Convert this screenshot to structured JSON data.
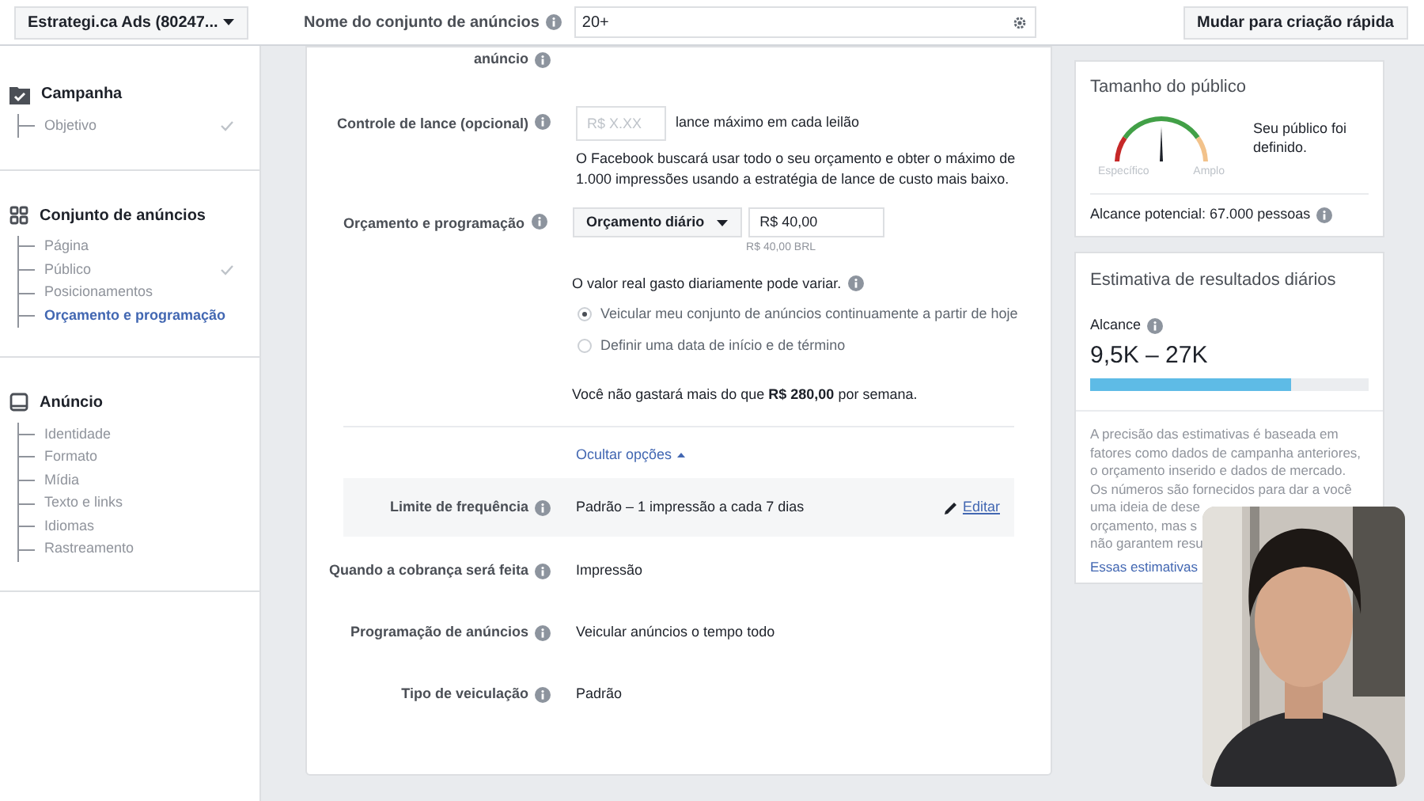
{
  "header": {
    "account": "Estrategi.ca Ads (80247...",
    "name_label": "Nome do conjunto de anúncios",
    "name_value": "20+",
    "quick_button": "Mudar para criação rápida"
  },
  "sidebar": [
    {
      "title": "Campanha",
      "kind": "campaign",
      "items": [
        {
          "label": "Objetivo",
          "checked": true,
          "selected": false
        }
      ]
    },
    {
      "title": "Conjunto de anúncios",
      "kind": "adset",
      "items": [
        {
          "label": "Página",
          "checked": false,
          "selected": false
        },
        {
          "label": "Público",
          "checked": true,
          "selected": false
        },
        {
          "label": "Posicionamentos",
          "checked": false,
          "selected": false
        },
        {
          "label": "Orçamento e programação",
          "checked": false,
          "selected": true
        }
      ]
    },
    {
      "title": "Anúncio",
      "kind": "ad",
      "items": [
        {
          "label": "Identidade",
          "checked": false,
          "selected": false
        },
        {
          "label": "Formato",
          "checked": false,
          "selected": false
        },
        {
          "label": "Mídia",
          "checked": false,
          "selected": false
        },
        {
          "label": "Texto e links",
          "checked": false,
          "selected": false
        },
        {
          "label": "Idiomas",
          "checked": false,
          "selected": false
        },
        {
          "label": "Rastreamento",
          "checked": false,
          "selected": false
        }
      ]
    }
  ],
  "form": {
    "top_label_tail": "anúncio",
    "bid": {
      "label": "Controle de lance (opcional)",
      "placeholder": "R$ X.XX",
      "suffix": "lance máximo em cada leilão",
      "note": "O Facebook buscará usar todo o seu orçamento e obter o máximo de 1.000 impressões usando a estratégia de lance de custo mais baixo."
    },
    "budget": {
      "label": "Orçamento e programação",
      "type": "Orçamento diário",
      "amount": "R$ 40,00",
      "amount_hint": "R$ 40,00 BRL",
      "variation": "O valor real gasto diariamente pode variar.",
      "options": [
        {
          "label": "Veicular meu conjunto de anúncios continuamente a partir de hoje",
          "selected": true
        },
        {
          "label": "Definir uma data de início e de término",
          "selected": false
        }
      ],
      "weekly": "Você não gastará mais do que **R$ 280,00** por semana."
    },
    "hide_link": "Ocultar opções",
    "rows": [
      {
        "label": "Limite de frequência",
        "value": "Padrão – 1 impressão a cada 7 dias",
        "edit": "Editar",
        "highlighted": true
      },
      {
        "label": "Quando a cobrança será feita",
        "value": "Impressão",
        "highlighted": false
      },
      {
        "label": "Programação de anúncios",
        "value": "Veicular anúncios o tempo todo",
        "highlighted": false
      },
      {
        "label": "Tipo de veiculação",
        "value": "Padrão",
        "highlighted": false
      }
    ]
  },
  "audience": {
    "title": "Tamanho do público",
    "left": "Específico",
    "right": "Amplo",
    "status": "Seu público foi definido.",
    "reach": "Alcance potencial: 67.000 pessoas"
  },
  "estimate": {
    "title": "Estimativa de resultados diários",
    "metric": "Alcance",
    "range": "9,5K – 27K",
    "level": 0.72,
    "note_lines": [
      "A precisão das estimativas é baseada em",
      "fatores como dados de campanha anteriores,",
      "o orçamento inserido e dados de mercado.",
      "Os números são fornecidos para dar a você",
      "uma ideia de dese",
      "orçamento, mas s",
      "não garantem resu"
    ],
    "link": "Essas estimativas"
  }
}
